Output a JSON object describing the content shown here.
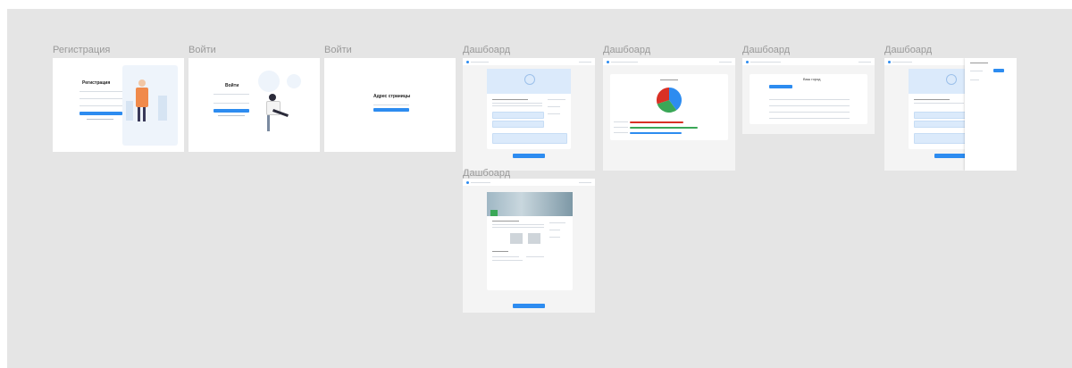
{
  "frames": [
    {
      "id": "registration",
      "title": "Регистрация",
      "heading": "Регистрация"
    },
    {
      "id": "login",
      "title": "Войти",
      "heading": "Войти"
    },
    {
      "id": "page-address",
      "title": "Войти",
      "heading": "Адрес страницы"
    },
    {
      "id": "dashboard-1",
      "title": "Дашбоард"
    },
    {
      "id": "dashboard-2",
      "title": "Дашбоард"
    },
    {
      "id": "dashboard-3",
      "title": "Дашбоард",
      "heading": "Ваш город"
    },
    {
      "id": "dashboard-4",
      "title": "Дашбоард"
    },
    {
      "id": "dashboard-5",
      "title": "Дашбоард"
    }
  ],
  "chart_data": {
    "type": "pie",
    "values": [
      40,
      30,
      30
    ],
    "colors": [
      "#2d8cf0",
      "#3aa757",
      "#d93025"
    ]
  },
  "colors": {
    "canvas": "#e5e5e5",
    "accent": "#2d8cf0",
    "pale": "#dbeafb",
    "green": "#3aa757",
    "red": "#d93025",
    "figure_orange": "#f08a4b"
  }
}
